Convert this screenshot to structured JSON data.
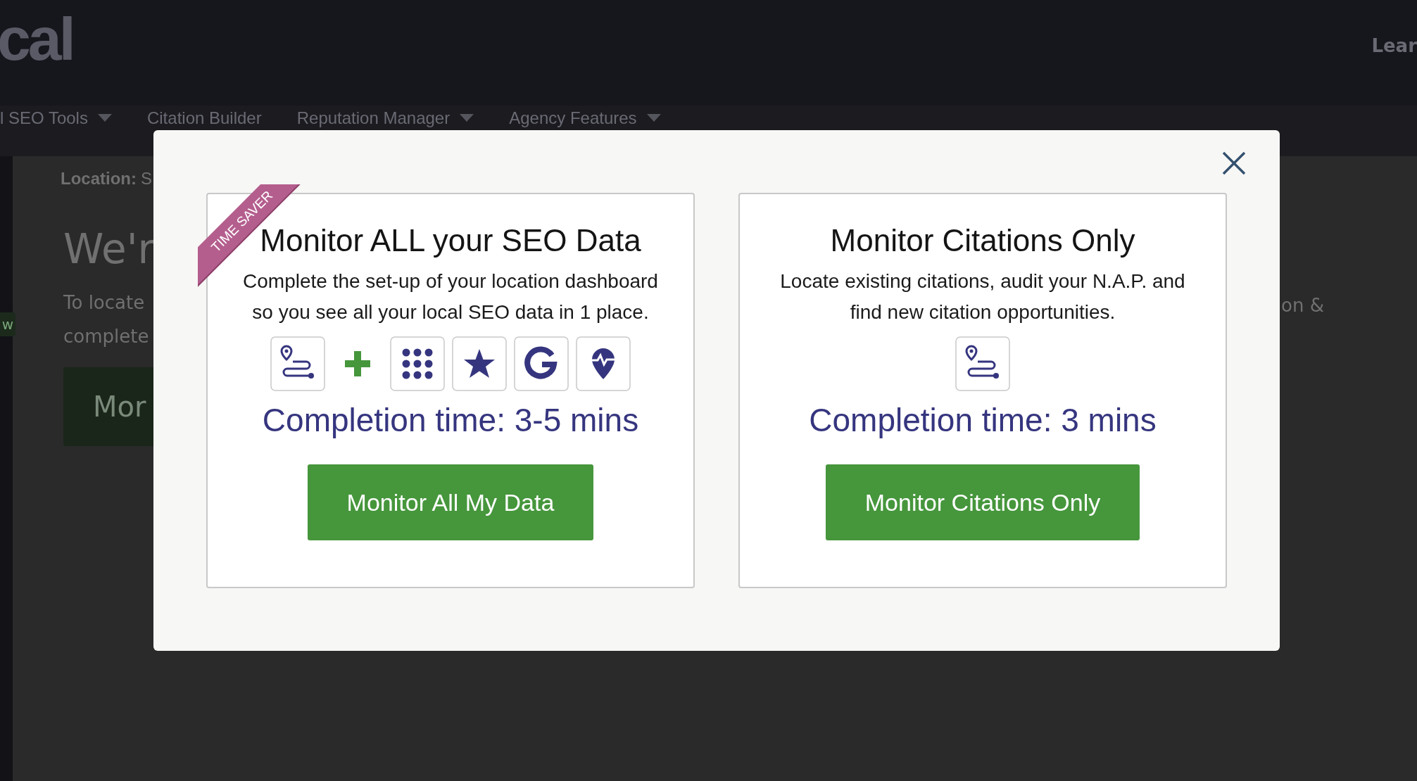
{
  "header": {
    "logo": "cal",
    "link": "Lear"
  },
  "nav": [
    {
      "label": "l SEO Tools",
      "dropdown": true
    },
    {
      "label": "Citation Builder",
      "dropdown": false
    },
    {
      "label": "Reputation Manager",
      "dropdown": true
    },
    {
      "label": "Agency Features",
      "dropdown": true
    }
  ],
  "page": {
    "side_badge": "w",
    "location_label": "Location:",
    "location_value": "S",
    "heading": "We'r",
    "intro_lines": [
      "To locate",
      "complete"
    ],
    "intro_right": "on &",
    "button": "Mor"
  },
  "modal": {
    "options": [
      {
        "ribbon": "TIME SAVER",
        "title": "Monitor ALL your SEO Data",
        "description": "Complete the set-up of your location dashboard so you see all your local SEO data in 1 place.",
        "icons": [
          {
            "kind": "route"
          },
          {
            "kind": "plus"
          },
          {
            "kind": "grid"
          },
          {
            "kind": "star"
          },
          {
            "kind": "g"
          },
          {
            "kind": "pin-pulse"
          }
        ],
        "completion": "Completion time: 3-5 mins",
        "button": "Monitor All My Data"
      },
      {
        "title": "Monitor Citations Only",
        "description": "Locate existing citations, audit your N.A.P. and find new citation opportunities.",
        "icons": [
          {
            "kind": "route"
          }
        ],
        "completion": "Completion time: 3 mins",
        "button": "Monitor Citations Only"
      }
    ]
  }
}
